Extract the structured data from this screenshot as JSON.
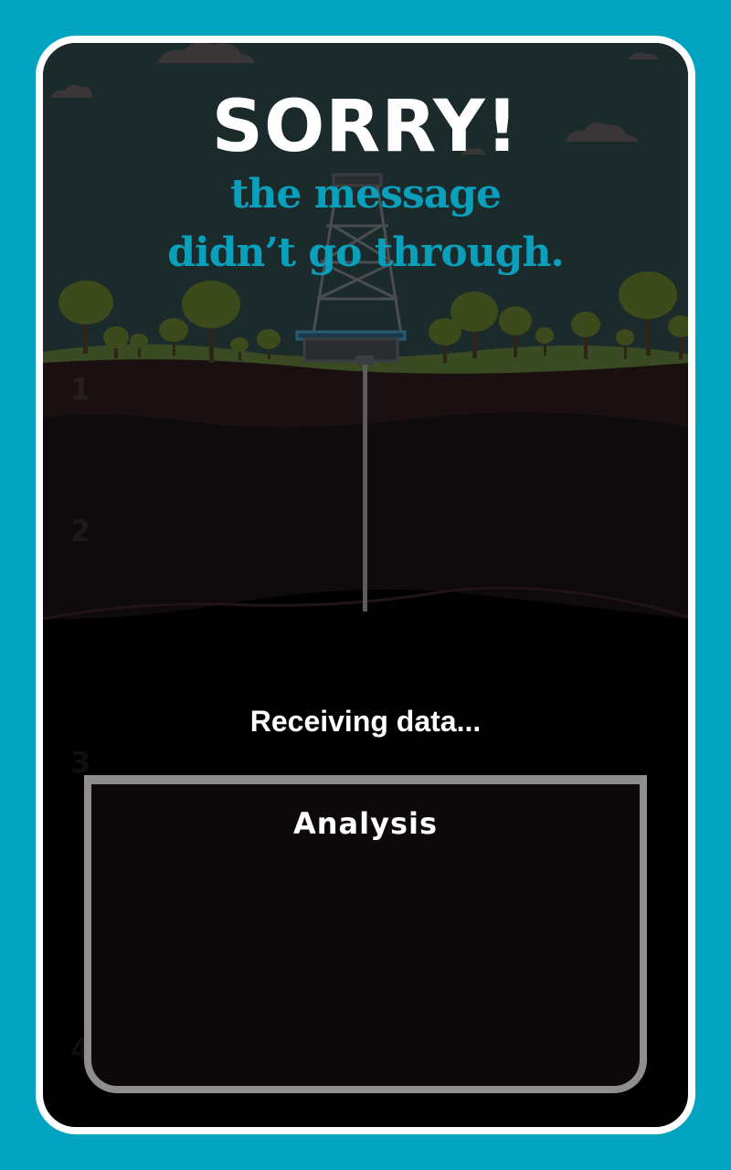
{
  "message": {
    "title": "SORRY!",
    "line1": "the message",
    "line2": "didn’t go through."
  },
  "layers": {
    "l1": "1",
    "l2": "2",
    "l3": "3",
    "l4": "4"
  },
  "status": {
    "text": "Receiving data..."
  },
  "analysis": {
    "title": "Analysis"
  },
  "colors": {
    "background": "#00a3c0",
    "accent": "#0aa0bc",
    "panel_border": "#8e8e8e"
  },
  "icons": [
    "cloud-icon",
    "tree-icon",
    "drilling-rig-icon",
    "drill-pipe-icon"
  ]
}
